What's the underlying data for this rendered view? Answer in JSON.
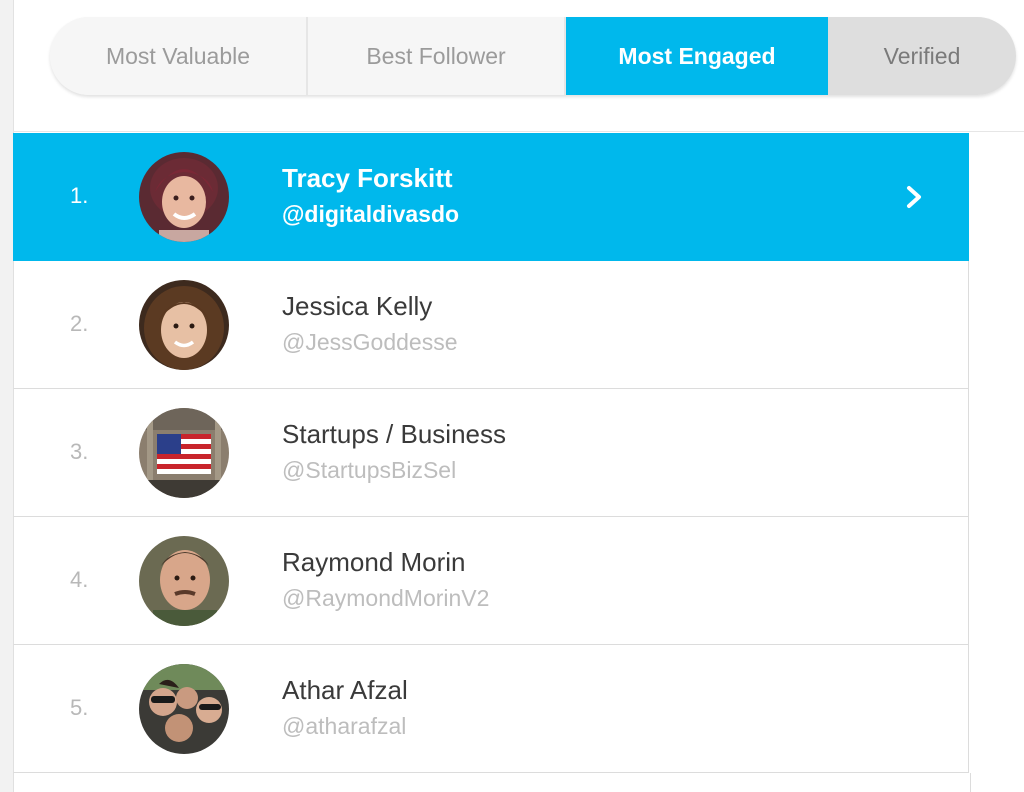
{
  "tabs": [
    {
      "label": "Most Valuable"
    },
    {
      "label": "Best Follower"
    },
    {
      "label": "Most Engaged"
    },
    {
      "label": "Verified"
    }
  ],
  "active_tab": "Most Engaged",
  "accent_color": "#00b8ec",
  "users": [
    {
      "rank": "1.",
      "name": "Tracy Forskitt",
      "handle": "@digitaldivasdo"
    },
    {
      "rank": "2.",
      "name": "Jessica Kelly",
      "handle": "@JessGoddesse"
    },
    {
      "rank": "3.",
      "name": "Startups / Business",
      "handle": "@StartupsBizSel"
    },
    {
      "rank": "4.",
      "name": "Raymond Morin",
      "handle": "@RaymondMorinV2"
    },
    {
      "rank": "5.",
      "name": "Athar Afzal",
      "handle": "@atharafzal"
    }
  ],
  "selected_row_icon": "chevron-right-icon"
}
